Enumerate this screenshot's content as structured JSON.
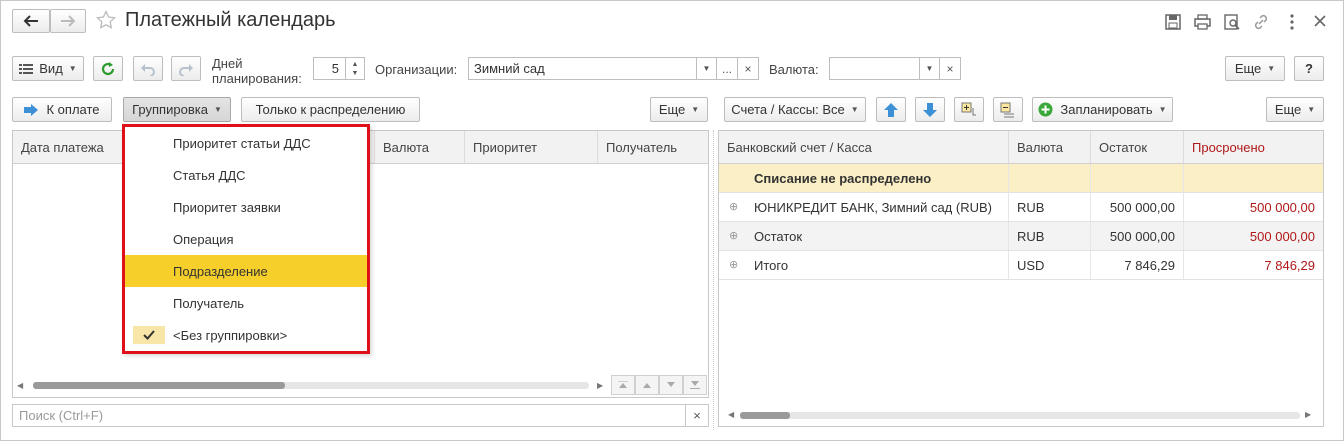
{
  "window": {
    "title": "Платежный календарь"
  },
  "toolbar": {
    "view_label": "Вид",
    "days_label": "Дней\nпланирования:",
    "days_value": "5",
    "org_label": "Организации:",
    "org_value": "Зимний сад",
    "org_more": "...",
    "currency_label": "Валюта:",
    "currency_value": "",
    "more_label": "Еще",
    "help_label": "?"
  },
  "left_bar": {
    "to_pay_label": "К оплате",
    "grouping_label": "Группировка",
    "only_distribution_label": "Только к распределению",
    "more_label": "Еще"
  },
  "left_table": {
    "columns": [
      "Дата платежа",
      "Валюта",
      "Приоритет",
      "Получатель"
    ]
  },
  "grouping_menu": {
    "items": [
      {
        "label": "Приоритет статьи ДДС",
        "highlighted": false,
        "checked": false
      },
      {
        "label": "Статья ДДС",
        "highlighted": false,
        "checked": false
      },
      {
        "label": "Приоритет заявки",
        "highlighted": false,
        "checked": false
      },
      {
        "label": "Операция",
        "highlighted": false,
        "checked": false
      },
      {
        "label": "Подразделение",
        "highlighted": true,
        "checked": false
      },
      {
        "label": "Получатель",
        "highlighted": false,
        "checked": false
      },
      {
        "label": "<Без группировки>",
        "highlighted": false,
        "checked": true
      }
    ]
  },
  "search": {
    "placeholder": "Поиск (Ctrl+F)",
    "clear": "×"
  },
  "right_bar": {
    "accounts_label": "Счета / Кассы: Все",
    "plan_label": "Запланировать",
    "more_label": "Еще"
  },
  "right_table": {
    "columns": [
      "Банковский счет / Касса",
      "Валюта",
      "Остаток",
      "Просрочено"
    ],
    "group_row": "Списание не распределено",
    "rows": [
      {
        "name": "ЮНИКРЕДИТ БАНК, Зимний сад (RUB)",
        "currency": "RUB",
        "balance": "500 000,00",
        "overdue": "500 000,00"
      },
      {
        "name": "Остаток",
        "currency": "RUB",
        "balance": "500 000,00",
        "overdue": "500 000,00"
      },
      {
        "name": "Итого",
        "currency": "USD",
        "balance": "7 846,29",
        "overdue": "7 846,29"
      }
    ]
  },
  "colors": {
    "accent_yellow": "#f6cf2b",
    "menu_border": "#e0101a",
    "overdue_red": "#b01818",
    "group_row_bg": "#fbefc6"
  }
}
